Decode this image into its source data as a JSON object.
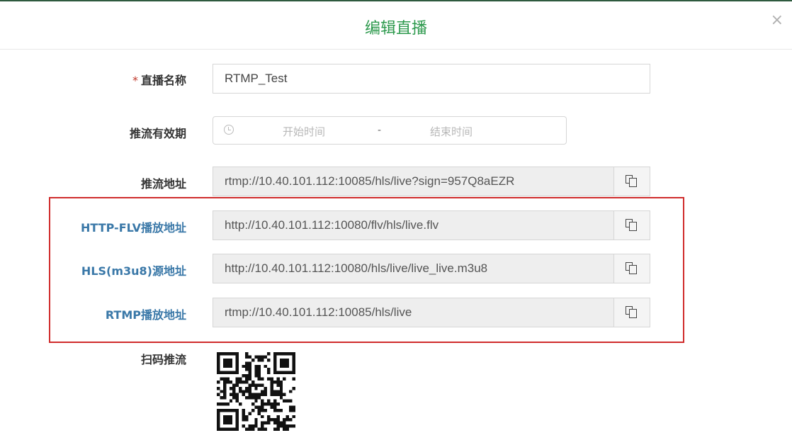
{
  "modal": {
    "title": "编辑直播",
    "close_label": "×"
  },
  "form": {
    "name": {
      "required_mark": "*",
      "label": "直播名称",
      "value": "RTMP_Test"
    },
    "validity": {
      "label": "推流有效期",
      "start_placeholder": "开始时间",
      "separator": "-",
      "end_placeholder": "结束时间",
      "icon": "clock-icon"
    },
    "push_url": {
      "label": "推流地址",
      "value": "rtmp://10.40.101.112:10085/hls/live?sign=957Q8aEZR"
    },
    "play_addresses": [
      {
        "label": "HTTP-FLV播放地址",
        "value": "http://10.40.101.112:10080/flv/hls/live.flv"
      },
      {
        "label": "HLS(m3u8)源地址",
        "value": "http://10.40.101.112:10080/hls/live/live_live.m3u8"
      },
      {
        "label": "RTMP播放地址",
        "value": "rtmp://10.40.101.112:10085/hls/live"
      }
    ],
    "qr": {
      "label": "扫码推流"
    }
  },
  "colors": {
    "title": "#2e9a4e",
    "highlight_label": "#3a78a8",
    "highlight_border": "#d02c2c",
    "required": "#c0392b"
  }
}
